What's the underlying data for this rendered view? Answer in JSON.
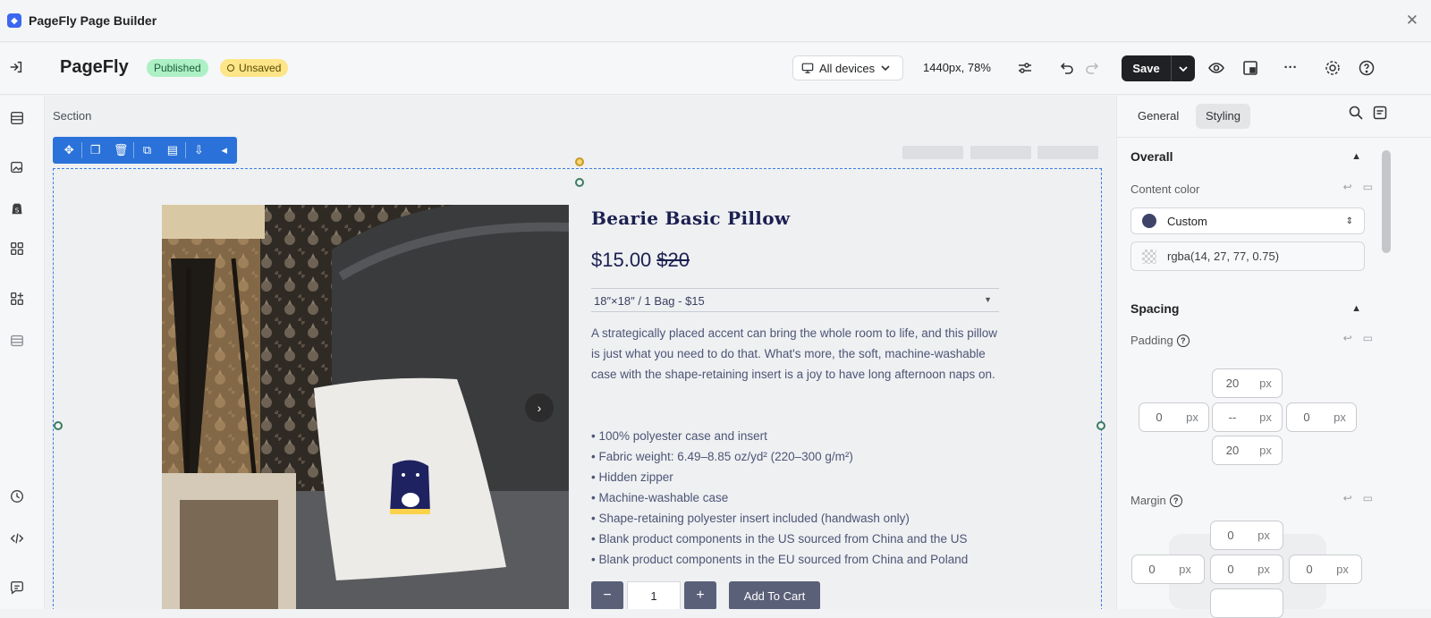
{
  "window": {
    "title": "PageFly Page Builder",
    "close": "✕"
  },
  "header": {
    "brand": "PageFly",
    "status_published": "Published",
    "status_unsaved": "Unsaved",
    "device": "All devices",
    "zoom": "1440px, 78%",
    "save_label": "Save"
  },
  "canvas": {
    "section_label": "Section",
    "product": {
      "title": "Bearie Basic Pillow",
      "price": "$15.00",
      "compare_price": "$20",
      "variant": "18″×18″ / 1 Bag - $15",
      "description": "A strategically placed accent can bring the whole room to life, and this pillow is just what you need to do that. What's more, the soft, machine-washable case with the shape-retaining insert is a joy to have long afternoon naps on.",
      "bullets": [
        "• 100% polyester case and insert",
        "• Fabric weight: 6.49–8.85 oz/yd² (220–300 g/m²)",
        "• Hidden zipper",
        "• Machine-washable case",
        "• Shape-retaining polyester insert included (handwash only)",
        "• Blank product components in the US sourced from China and the US",
        "• Blank product components in the EU sourced from China and Poland"
      ],
      "quantity": "1",
      "qty_minus": "−",
      "qty_plus": "+",
      "add_to_cart": "Add To Cart"
    }
  },
  "panel": {
    "tabs": [
      "General",
      "Styling"
    ],
    "overall": {
      "title": "Overall",
      "content_color_label": "Content color",
      "color_mode": "Custom",
      "color_value": "rgba(14, 27, 77, 0.75)",
      "swatch_color": "#3e4468"
    },
    "spacing": {
      "title": "Spacing",
      "padding_label": "Padding",
      "padding": {
        "top": "20",
        "left": "0",
        "center": "--",
        "right": "0",
        "bottom": "20"
      },
      "margin_label": "Margin",
      "margin": {
        "top": "0",
        "left": "0",
        "center": "0",
        "right": "0"
      },
      "unit": "px"
    }
  },
  "colors": {
    "accent": "#2a72d9",
    "published_bg": "#aef0c6",
    "unsaved_bg": "#fde588",
    "product_title": "#1b2050"
  }
}
